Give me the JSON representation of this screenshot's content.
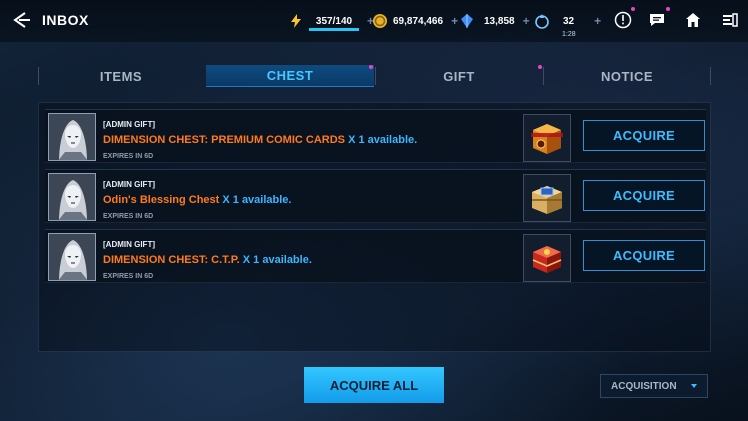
{
  "header": {
    "title": "INBOX",
    "energy": {
      "value": "357/140",
      "fill_fraction": 1.0
    },
    "gold": {
      "value": "69,874,466"
    },
    "crystals": {
      "value": "13,858"
    },
    "stamina": {
      "value": "32",
      "timer": "1:28"
    },
    "plus_symbol": "+"
  },
  "tabs": [
    {
      "label": "ITEMS",
      "active": false
    },
    {
      "label": "CHEST",
      "active": true
    },
    {
      "label": "GIFT",
      "active": false
    },
    {
      "label": "NOTICE",
      "active": false
    }
  ],
  "messages": [
    {
      "tag": "[ADMIN GIFT]",
      "item_name": "DIMENSION CHEST: PREMIUM COMIC CARDS",
      "quantity": "X 1 available.",
      "expires": "EXPIRES IN 6D",
      "button": "ACQUIRE",
      "chest_icon": "dimension-chest-comic-icon"
    },
    {
      "tag": "[ADMIN GIFT]",
      "item_name": "Odin's Blessing Chest",
      "quantity": "X 1 available.",
      "expires": "EXPIRES IN 6D",
      "button": "ACQUIRE",
      "chest_icon": "odin-blessing-chest-icon"
    },
    {
      "tag": "[ADMIN GIFT]",
      "item_name": "DIMENSION CHEST: C.T.P.",
      "quantity": "X 1 available.",
      "expires": "EXPIRES IN 6D",
      "button": "ACQUIRE",
      "chest_icon": "dimension-chest-ctp-icon"
    }
  ],
  "footer": {
    "acquire_all": "ACQUIRE ALL",
    "sort_dropdown": "ACQUISITION"
  },
  "colors": {
    "accent": "#3bbcff",
    "item_name": "#ff7a1a",
    "notification_dot": "#e546c8"
  }
}
